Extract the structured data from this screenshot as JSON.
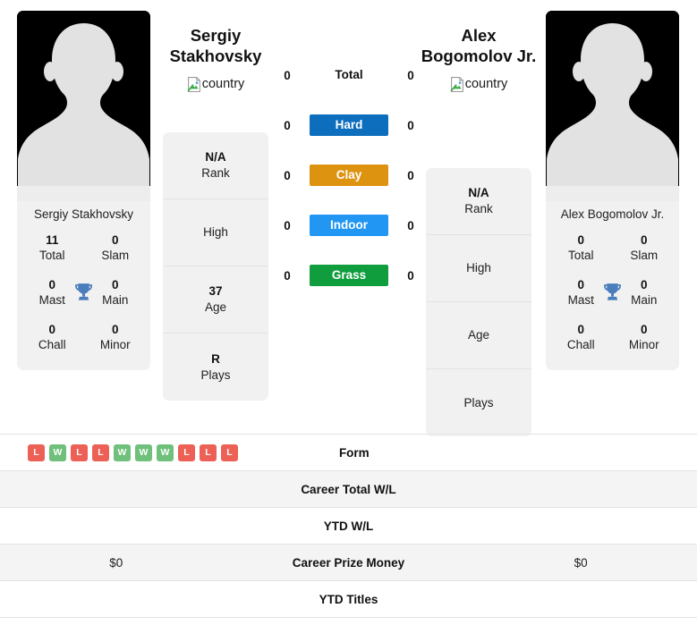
{
  "players": {
    "left": {
      "first_name": "Sergiy",
      "last_name": "Stakhovsky",
      "full_name": "Sergiy Stakhovsky",
      "country_alt": "country",
      "photo_alt": "Sergiy Stakhovsky photo",
      "titles": [
        {
          "value": "11",
          "label": "Total"
        },
        {
          "value": "0",
          "label": "Slam"
        },
        {
          "value": "0",
          "label": "Mast"
        },
        {
          "value": "0",
          "label": "Main"
        },
        {
          "value": "0",
          "label": "Chall"
        },
        {
          "value": "0",
          "label": "Minor"
        }
      ],
      "info": [
        {
          "value": "N/A",
          "label": "Rank"
        },
        {
          "value": "",
          "label": "High"
        },
        {
          "value": "37",
          "label": "Age"
        },
        {
          "value": "R",
          "label": "Plays"
        }
      ],
      "surface_counts": {
        "total": "0",
        "hard": "0",
        "clay": "0",
        "indoor": "0",
        "grass": "0"
      },
      "form": [
        "L",
        "W",
        "L",
        "L",
        "W",
        "W",
        "W",
        "L",
        "L",
        "L"
      ],
      "career_total_wl": "",
      "ytd_wl": "",
      "career_prize_money": "$0",
      "ytd_titles": ""
    },
    "right": {
      "first_name": "Alex",
      "last_name": "Bogomolov Jr.",
      "full_name": "Alex Bogomolov Jr.",
      "country_alt": "country",
      "photo_alt": "Alex Bogomolov Jr. photo",
      "titles": [
        {
          "value": "0",
          "label": "Total"
        },
        {
          "value": "0",
          "label": "Slam"
        },
        {
          "value": "0",
          "label": "Mast"
        },
        {
          "value": "0",
          "label": "Main"
        },
        {
          "value": "0",
          "label": "Chall"
        },
        {
          "value": "0",
          "label": "Minor"
        }
      ],
      "info": [
        {
          "value": "N/A",
          "label": "Rank"
        },
        {
          "value": "",
          "label": "High"
        },
        {
          "value": "",
          "label": "Age"
        },
        {
          "value": "",
          "label": "Plays"
        }
      ],
      "surface_counts": {
        "total": "0",
        "hard": "0",
        "clay": "0",
        "indoor": "0",
        "grass": "0"
      },
      "form": [],
      "career_total_wl": "",
      "ytd_wl": "",
      "career_prize_money": "$0",
      "ytd_titles": ""
    }
  },
  "surfaces": [
    {
      "key": "total",
      "label": "Total",
      "color": "",
      "text_color": "#111111",
      "tinted": false
    },
    {
      "key": "hard",
      "label": "Hard",
      "color": "#0d6ebd",
      "text_color": "#ffffff",
      "tinted": true
    },
    {
      "key": "clay",
      "label": "Clay",
      "color": "#dd9310",
      "text_color": "#ffffff",
      "tinted": true
    },
    {
      "key": "indoor",
      "label": "Indoor",
      "color": "#2196f3",
      "text_color": "#ffffff",
      "tinted": true
    },
    {
      "key": "grass",
      "label": "Grass",
      "color": "#0f9d3e",
      "text_color": "#ffffff",
      "tinted": true
    }
  ],
  "stat_rows": [
    {
      "key": "form",
      "label": "Form"
    },
    {
      "key": "career_total_wl",
      "label": "Career Total W/L"
    },
    {
      "key": "ytd_wl",
      "label": "YTD W/L"
    },
    {
      "key": "career_prize_money",
      "label": "Career Prize Money"
    },
    {
      "key": "ytd_titles",
      "label": "YTD Titles"
    }
  ],
  "colors": {
    "win": "#6fc07a",
    "loss": "#ec6055",
    "trophy": "#4a7ebb",
    "card_bg": "#f1f1f1",
    "row_shaded": "#f4f4f4",
    "photo_bg": "#000000",
    "silhouette": "#e2e2e2"
  }
}
